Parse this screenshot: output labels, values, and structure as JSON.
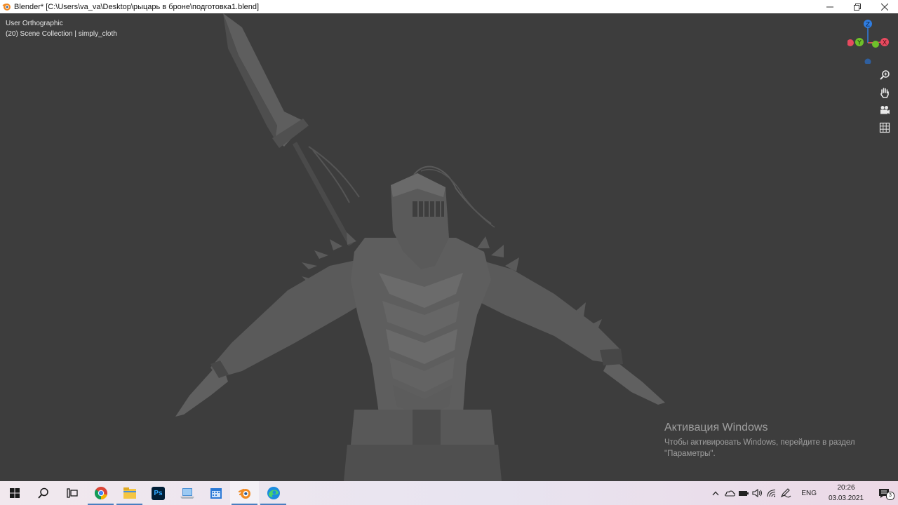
{
  "window": {
    "title": "Blender* [C:\\Users\\va_va\\Desktop\\рыцарь в броне\\подготовка1.blend]",
    "app_icon": "blender-icon",
    "controls": [
      "minimize-icon",
      "restore-icon",
      "close-icon"
    ]
  },
  "viewport": {
    "view_name": "User Orthographic",
    "collection_info": "(20) Scene Collection | simply_cloth",
    "gizmo": {
      "z_label": "Z",
      "y_label": "Y",
      "x_label": "X",
      "z_color": "#2f7de1",
      "y_color": "#6ec02a",
      "x_color": "#e84a5f"
    },
    "nav_buttons": [
      "zoom-icon",
      "pan-hand-icon",
      "camera-icon",
      "grid-icon"
    ],
    "background_color": "#3d3d3d",
    "model_color": "#5c5c5c"
  },
  "activation": {
    "heading": "Активация Windows",
    "line1": "Чтобы активировать Windows, перейдите в раздел",
    "line2": "\"Параметры\"."
  },
  "taskbar": {
    "apps": [
      "windows-start-icon",
      "search-icon",
      "task-view-icon",
      "chrome-icon",
      "file-explorer-icon",
      "photoshop-icon",
      "laptop-icon",
      "calendar-icon",
      "blender-icon",
      "edge-icon"
    ],
    "photoshop_label": "Ps",
    "tray_icons": [
      "chevron-up-icon",
      "onedrive-icon",
      "battery-icon",
      "volume-icon",
      "wifi-icon",
      "pen-icon"
    ],
    "language": "ENG",
    "time": "20:26",
    "date": "03.03.2021",
    "notification_count": "3"
  }
}
